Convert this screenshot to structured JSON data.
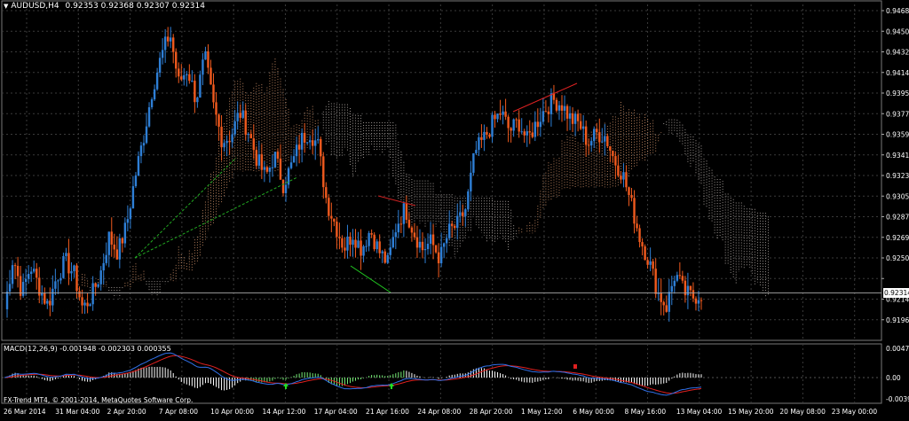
{
  "window": {
    "symbol_title": "AUDUSD,H4",
    "ohlc": "0.92353 0.92368 0.92307 0.92314"
  },
  "macd": {
    "title": "MACD(12,26,9) -0.001948 -0.002303 0.000355",
    "scale": [
      "0.004706",
      "0.00",
      "-0.0039"
    ]
  },
  "copyright": "FX-Trend MT4, © 2001-2014, MetaQuotes Software Corp.",
  "colors": {
    "background": "#000000",
    "grid": "#3a3a3a",
    "bull_candle": "#2e7fd6",
    "bear_candle": "#f05a1e",
    "cloud_up": "#d2936a",
    "cloud_down": "#b8b0ab",
    "macd_line": "#3070e8",
    "signal_line": "#e02020",
    "histogram": "#ffffff",
    "green_arrow": "#22dd22"
  },
  "chart_data": {
    "type": "candlestick",
    "symbol": "AUDUSD",
    "timeframe": "H4",
    "current_price": 0.92314,
    "y_ticks": [
      "0.94680",
      "0.94500",
      "0.94320",
      "0.94140",
      "0.93955",
      "0.93775",
      "0.93595",
      "0.93415",
      "0.93230",
      "0.93050",
      "0.92870",
      "0.92690",
      "0.92505",
      "0.92314",
      "0.92140",
      "0.91965"
    ],
    "x_ticks": [
      "26 Mar 2014",
      "31 Mar 04:00",
      "2 Apr 20:00",
      "7 Apr 08:00",
      "10 Apr 00:00",
      "14 Apr 12:00",
      "17 Apr 04:00",
      "21 Apr 16:00",
      "24 Apr 08:00",
      "28 Apr 20:00",
      "1 May 12:00",
      "6 May 00:00",
      "8 May 16:00",
      "13 May 04:00",
      "15 May 20:00",
      "20 May 08:00",
      "23 May 00:00"
    ],
    "ylim": [
      0.9192,
      0.9475
    ],
    "price_path": [
      0.9218,
      0.9262,
      0.9231,
      0.9254,
      0.9236,
      0.9221,
      0.9245,
      0.9258,
      0.9247,
      0.9218,
      0.9229,
      0.9247,
      0.9278,
      0.9265,
      0.9287,
      0.9328,
      0.9362,
      0.9402,
      0.9428,
      0.9448,
      0.9406,
      0.9418,
      0.9392,
      0.9428,
      0.9386,
      0.9358,
      0.9362,
      0.9382,
      0.9366,
      0.9342,
      0.9328,
      0.9346,
      0.9322,
      0.9338,
      0.9358,
      0.9366,
      0.9354,
      0.9307,
      0.9288,
      0.9269,
      0.9281,
      0.9268,
      0.9284,
      0.9266,
      0.9256,
      0.9288,
      0.9302,
      0.9282,
      0.9268,
      0.9274,
      0.926,
      0.9282,
      0.9288,
      0.9302,
      0.9348,
      0.9359,
      0.9372,
      0.9382,
      0.9366,
      0.9374,
      0.9358,
      0.9372,
      0.9384,
      0.9392,
      0.9388,
      0.9376,
      0.9372,
      0.9356,
      0.9364,
      0.9362,
      0.9342,
      0.933,
      0.9304,
      0.9276,
      0.9258,
      0.9232,
      0.922,
      0.9248,
      0.9232,
      0.9228,
      0.9231
    ]
  }
}
